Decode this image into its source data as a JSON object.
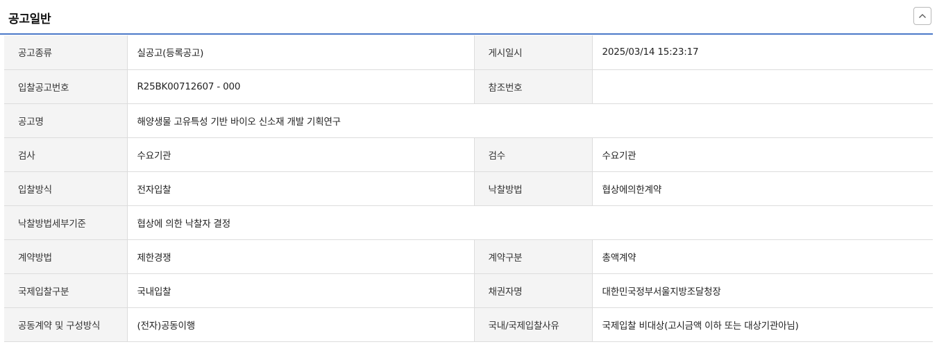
{
  "panel": {
    "title": "공고일반",
    "collapse_icon": "chevron-up-icon"
  },
  "rows": [
    {
      "l1": "공고종류",
      "v1": "실공고(등록공고)",
      "l2": "게시일시",
      "v2": "2025/03/14 15:23:17"
    },
    {
      "l1": "입찰공고번호",
      "v1": "R25BK00712607 - 000",
      "l2": "참조번호",
      "v2": ""
    },
    {
      "l1": "공고명",
      "v1": "해양생물 고유특성 기반 바이오 신소재 개발 기획연구"
    },
    {
      "l1": "검사",
      "v1": "수요기관",
      "l2": "검수",
      "v2": "수요기관"
    },
    {
      "l1": "입찰방식",
      "v1": "전자입찰",
      "l2": "낙찰방법",
      "v2": "협상에의한계약"
    },
    {
      "l1": "낙찰방법세부기준",
      "v1": "협상에 의한 낙찰자 결정"
    },
    {
      "l1": "계약방법",
      "v1": "제한경쟁",
      "l2": "계약구분",
      "v2": "총액계약"
    },
    {
      "l1": "국제입찰구분",
      "v1": "국내입찰",
      "l2": "채권자명",
      "v2": "대한민국정부서울지방조달청장"
    },
    {
      "l1": "공동계약 및 구성방식",
      "v1": "(전자)공동이행",
      "l2": "국내/국제입찰사유",
      "v2": "국제입찰 비대상(고시금액 이하 또는 대상기관아님)"
    }
  ]
}
